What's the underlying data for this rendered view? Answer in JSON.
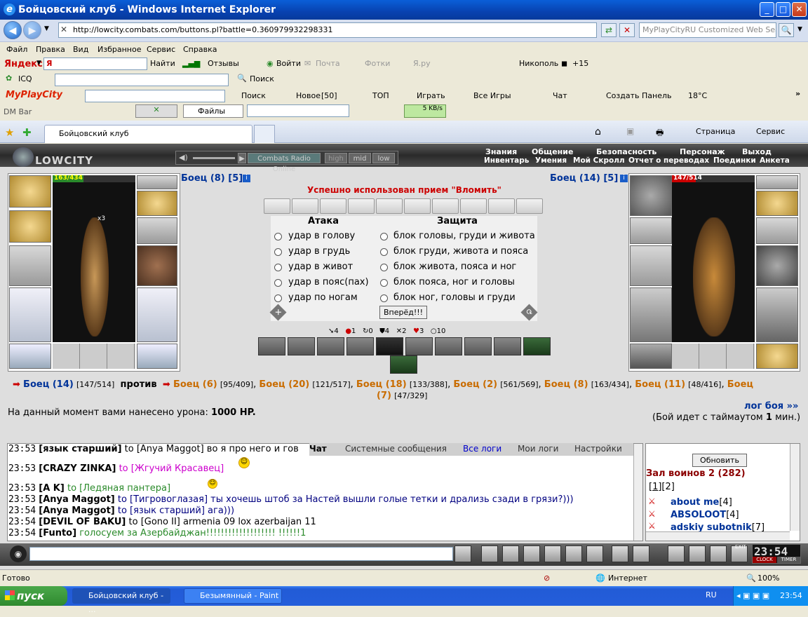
{
  "window": {
    "title": "Бойцовский клуб - Windows Internet Explorer"
  },
  "address": {
    "url": "http://lowcity.combats.com/buttons.pl?battle=0.360979932298331",
    "search_placeholder": "MyPlayCityRU Customized Web Search"
  },
  "menu": [
    "Файл",
    "Правка",
    "Вид",
    "Избранное",
    "Сервис",
    "Справка"
  ],
  "yandex": {
    "label": "Яндекс",
    "find": "Найти",
    "feedback": "Отзывы",
    "login": "Войти",
    "mail": "Почта",
    "photos": "Фотки",
    "yaru": "Я.ру",
    "city": "Никополь",
    "temp": "+15"
  },
  "icqbar": {
    "icq": "ICQ",
    "search": "Поиск"
  },
  "playcity": {
    "logo": "MyPlayCity",
    "search": "Поиск",
    "new": "Новое",
    "new_count": "[50]",
    "top": "ТОП",
    "play": "Играть",
    "all_games": "Все Игры",
    "chat": "Чат",
    "create_panel": "Создать Панель",
    "temp": "18°C"
  },
  "dmbar": {
    "label": "DM Bar",
    "files": "Файлы",
    "speed": "5 KB/s"
  },
  "tab": {
    "title": "Бойцовский клуб"
  },
  "cmdbar": {
    "page": "Страница",
    "service": "Сервис"
  },
  "game": {
    "logo": "LOWCITY",
    "radio": {
      "name": "Combats Radio Online",
      "high": "high",
      "mid": "mid",
      "low": "low"
    },
    "top_menu": [
      "Знания",
      "Общение",
      "Безопасность",
      "Персонаж",
      "Выход"
    ],
    "sub_menu": [
      "Инвентарь",
      "Умения",
      "Мой Скролл",
      "Отчет о переводах",
      "Поединки",
      "Анкета"
    ],
    "left_fighter": {
      "name": "Боец (8)",
      "level": "[5]",
      "hp": "163/434",
      "hp_frac": 0.376,
      "x3": "x3"
    },
    "right_fighter": {
      "name": "Боец (14)",
      "level": "[5]",
      "hp": "147/514",
      "hp_frac": 0.286
    },
    "status_message": "Успешно использован прием \"Вломить\"",
    "attack_title": "Атака",
    "defense_title": "Защита",
    "attacks": [
      "удар в голову",
      "удар в грудь",
      "удар в живот",
      "удар в пояс(пах)",
      "удар по ногам"
    ],
    "defenses": [
      "блок головы, груди и живота",
      "блок груди, живота и пояса",
      "блок живота, пояса и ног",
      "блок пояса, ног и головы",
      "блок ног, головы и груди"
    ],
    "forward_button": "Вперёд!!!",
    "stats": [
      "4",
      "1",
      "0",
      "4",
      "2",
      "3",
      "10"
    ],
    "battle_line": {
      "me": "Боец (14)",
      "me_hp": "[147/514]",
      "vs": "против",
      "enemies": [
        {
          "name": "Боец (6)",
          "hp": "[95/409]"
        },
        {
          "name": "Боец (20)",
          "hp": "[121/517]"
        },
        {
          "name": "Боец (18)",
          "hp": "[133/388]"
        },
        {
          "name": "Боец (2)",
          "hp": "[561/569]"
        },
        {
          "name": "Боец (8)",
          "hp": "[163/434]"
        },
        {
          "name": "Боец (11)",
          "hp": "[48/416]"
        },
        {
          "name": "Боец",
          "hp": ""
        }
      ],
      "last_enemy": {
        "name": "(7)",
        "hp": "[47/329]"
      }
    },
    "damage_text": "На данный момент вами нанесено урона:",
    "damage_value": "1000 HP.",
    "log_link": "лог боя »»",
    "timeout_text_a": "(Бой идет с таймаутом",
    "timeout_value": "1",
    "timeout_text_b": "мин.)"
  },
  "chat": {
    "tabs": [
      "Чат",
      "Системные сообщения",
      "Все логи",
      "Мои логи",
      "Настройки"
    ],
    "lines": [
      {
        "time": "23:53",
        "nick": "[язык старший]",
        "to": "to [Anya Maggot]",
        "text": "во я про него и гов"
      },
      {
        "time": "23:53",
        "nick": "[CRAZY ZINKA]",
        "to": "to [Жгучий Красавец]",
        "text": ""
      },
      {
        "time": "23:53",
        "nick": "[A K]",
        "to": "to [Ледяная пантера]",
        "text": ""
      },
      {
        "time": "23:53",
        "nick": "[Anya Maggot]",
        "to": "to [Тигровоглазая]",
        "text": "ты хочешь штоб за Настей вышли голые тетки и дрализь сзади в грязи?)))"
      },
      {
        "time": "23:54",
        "nick": "[Anya Maggot]",
        "to": "to [язык старший]",
        "text": "ага)))"
      },
      {
        "time": "23:54",
        "nick": "[DEVIL OF BAKU]",
        "to": "to [Gono II]",
        "text": "armenia 09 lox azerbaijan 11"
      },
      {
        "time": "23:54",
        "nick": "[Funto]",
        "to": "",
        "text": "голосуем за Азербайджан!!!!!!!!!!!!!!!!!!! !!!!!!1"
      }
    ]
  },
  "room": {
    "refresh": "Обновить",
    "title": "Зал воинов 2 (282)",
    "pages": [
      "1",
      "2"
    ],
    "players": [
      {
        "name": "about me",
        "level": "[4]"
      },
      {
        "name": "ABSOLOOT",
        "level": "[4]"
      },
      {
        "name": "adskiy subotnik",
        "level": "[7]"
      }
    ]
  },
  "clock": {
    "time": "23:54",
    "clock_label": "CLOCK",
    "timer_label": "TIMER",
    "exit": "EXIT"
  },
  "status": {
    "left": "Готово",
    "zone": "Интернет",
    "zoom": "100%"
  },
  "taskbar": {
    "start": "пуск",
    "tasks": [
      "Бойцовский клуб - ...",
      "Безымянный - Paint"
    ],
    "lang": "RU",
    "time": "23:54"
  }
}
